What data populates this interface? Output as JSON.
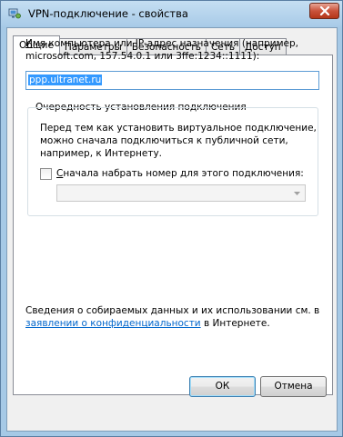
{
  "window": {
    "title": "VPN-подключение - свойства"
  },
  "tabs": [
    {
      "label": "Общие",
      "active": true
    },
    {
      "label": "Параметры",
      "active": false
    },
    {
      "label": "Безопасность",
      "active": false
    },
    {
      "label": "Сеть",
      "active": false
    },
    {
      "label": "Доступ",
      "active": false
    }
  ],
  "general": {
    "host_label_prefix": "",
    "host_label_underlined": "И",
    "host_label_rest": "мя компьютера или IP-адрес назначения (например,",
    "host_label_line2": "microsoft.com, 157.54.0.1 или 3ffe:1234::1111):",
    "host_value": "ppp.ultranet.ru",
    "group_title": "Очередность установления подключения",
    "description_lines": [
      "Перед тем как установить виртуальное подключение,",
      "можно сначала подключиться к публичной сети,",
      "например, к Интернету."
    ],
    "dial_first_underlined": "С",
    "dial_first_rest": "начала набрать номер для этого подключения:",
    "dial_first_checked": false,
    "dial_combo_value": "",
    "privacy_line1": "Сведения о собираемых данных и их использовании см. в",
    "privacy_link": "заявлении о конфиденциальности",
    "privacy_line2_rest": " в Интернете."
  },
  "buttons": {
    "ok": "ОК",
    "cancel": "Отмена"
  },
  "icons": {
    "app": "network-connection-icon",
    "close": "close-icon",
    "combo_arrow": "chevron-down-icon"
  },
  "colors": {
    "titlebar": "#a9cbe8",
    "close_button": "#c9523a",
    "link": "#0066cc",
    "selection": "#3399ff"
  }
}
